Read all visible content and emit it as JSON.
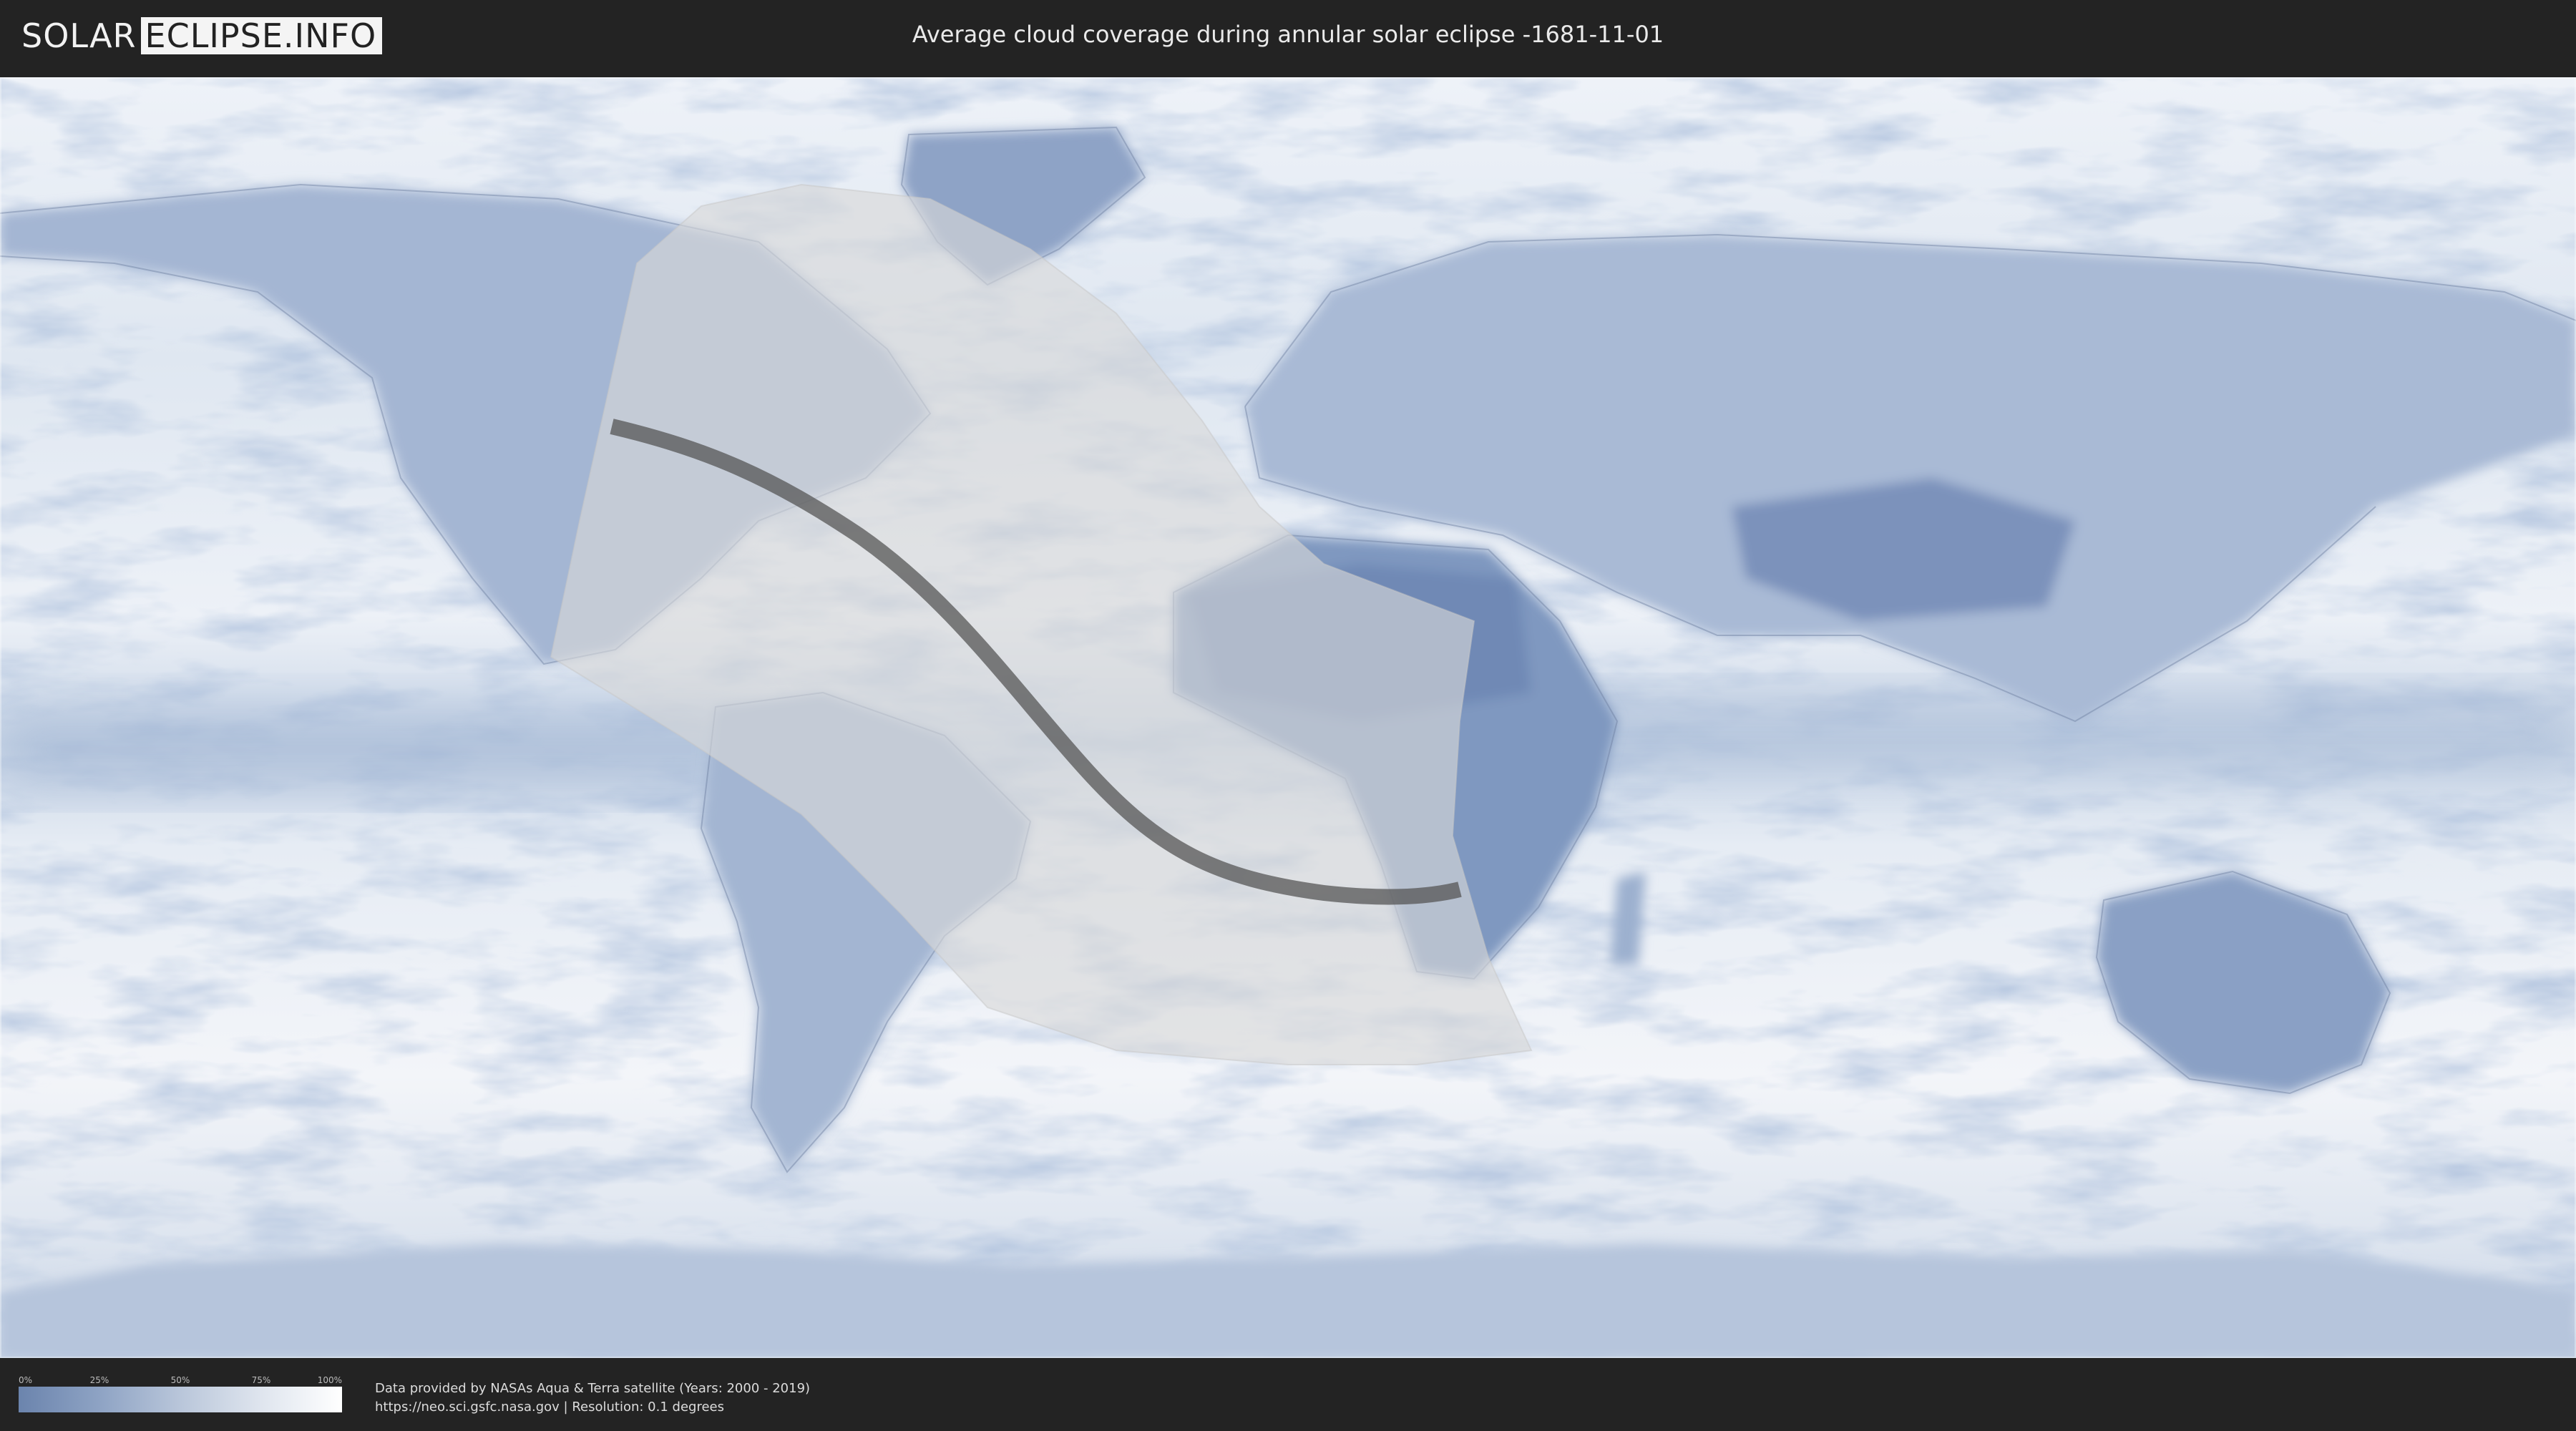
{
  "header": {
    "logo_left": "SOLAR",
    "logo_right": "ECLIPSE.INFO",
    "title": "Average cloud coverage during annular solar eclipse -1681-11-01"
  },
  "map": {
    "layers": [
      "cloud-coverage",
      "country-borders",
      "eclipse-visibility-zone",
      "eclipse-central-path"
    ],
    "colors": {
      "ocean_cloud": "#e8eef6",
      "land_low_cloud": "#7f98c0",
      "zone_fill": "#d9d9d9",
      "central_path": "#555555"
    }
  },
  "legend": {
    "ticks": [
      "0%",
      "25%",
      "50%",
      "75%",
      "100%"
    ],
    "gradient_start": "#6b84ad",
    "gradient_end": "#ffffff"
  },
  "footer": {
    "line1": "Data provided by NASAs Aqua & Terra satellite (Years: 2000 - 2019)",
    "line2": "https://neo.sci.gsfc.nasa.gov | Resolution: 0.1 degrees"
  }
}
